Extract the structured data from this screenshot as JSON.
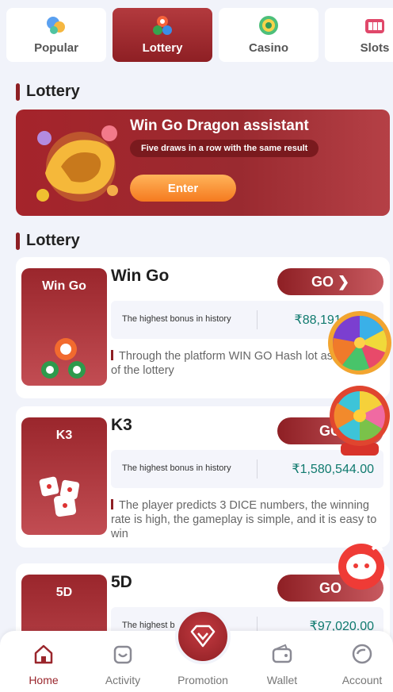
{
  "tabs": [
    {
      "label": "Popular",
      "icon": "popular-icon"
    },
    {
      "label": "Lottery",
      "icon": "lottery-balls-icon",
      "active": true
    },
    {
      "label": "Casino",
      "icon": "casino-chip-icon"
    },
    {
      "label": "Slots",
      "icon": "slots-icon"
    }
  ],
  "sections": {
    "banner_section_title": "Lottery",
    "games_section_title": "Lottery"
  },
  "banner": {
    "title": "Win Go Dragon assistant",
    "subtitle": "Five draws in a row with the same result",
    "button_label": "Enter"
  },
  "games": [
    {
      "thumb_label": "Win Go",
      "name": "Win Go",
      "go_label": "GO ❯",
      "bonus_label": "The highest bonus in history",
      "bonus_value": "₹88,191,1",
      "description": "Through the platform WIN GO Hash lot as the result of the lottery"
    },
    {
      "thumb_label": "K3",
      "name": "K3",
      "go_label": "GO",
      "bonus_label": "The highest bonus in history",
      "bonus_value": "₹1,580,544.00",
      "description": "The player predicts 3 DICE numbers, the winning rate is high, the gameplay is simple, and it is easy to win"
    },
    {
      "thumb_label": "5D",
      "name": "5D",
      "go_label": "GO",
      "bonus_label": "The highest b",
      "bonus_value": "₹97,020.00"
    }
  ],
  "nav": [
    {
      "label": "Home",
      "icon": "home-icon",
      "active": true
    },
    {
      "label": "Activity",
      "icon": "activity-icon"
    },
    {
      "label": "Promotion",
      "icon": "promotion-diamond-icon"
    },
    {
      "label": "Wallet",
      "icon": "wallet-icon"
    },
    {
      "label": "Account",
      "icon": "account-icon"
    }
  ],
  "colors": {
    "brand": "#8e1f24",
    "accent_orange": "#f57a1f",
    "bonus_text": "#0f7a6e",
    "background": "#f1f3fa"
  }
}
